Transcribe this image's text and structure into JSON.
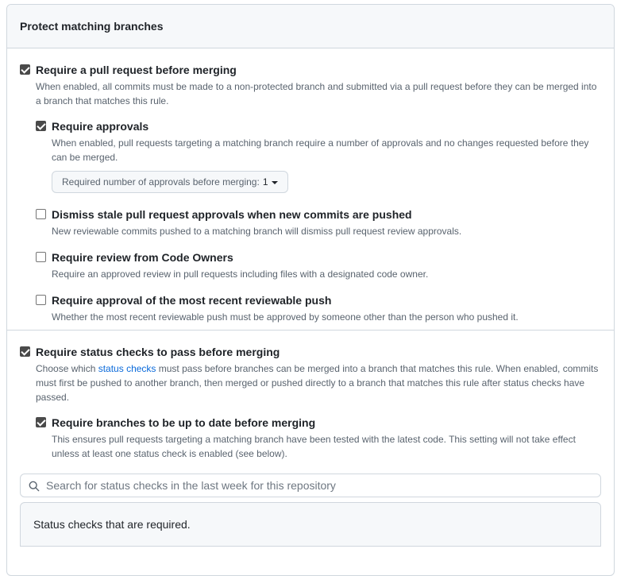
{
  "header": {
    "title": "Protect matching branches"
  },
  "pull_request": {
    "title": "Require a pull request before merging",
    "desc": "When enabled, all commits must be made to a non-protected branch and submitted via a pull request before they can be merged into a branch that matches this rule.",
    "checked": true,
    "options": [
      {
        "title": "Require approvals",
        "desc": "When enabled, pull requests targeting a matching branch require a number of approvals and no changes requested before they can be merged.",
        "checked": true
      },
      {
        "title": "Dismiss stale pull request approvals when new commits are pushed",
        "desc": "New reviewable commits pushed to a matching branch will dismiss pull request review approvals.",
        "checked": false
      },
      {
        "title": "Require review from Code Owners",
        "desc": "Require an approved review in pull requests including files with a designated code owner.",
        "checked": false
      },
      {
        "title": "Require approval of the most recent reviewable push",
        "desc": "Whether the most recent reviewable push must be approved by someone other than the person who pushed it.",
        "checked": false
      }
    ],
    "approvals_dropdown": {
      "label": "Required number of approvals before merging:",
      "value": "1"
    }
  },
  "status_checks": {
    "title": "Require status checks to pass before merging",
    "desc_before": "Choose which ",
    "desc_link": "status checks",
    "desc_after": " must pass before branches can be merged into a branch that matches this rule. When enabled, commits must first be pushed to another branch, then merged or pushed directly to a branch that matches this rule after status checks have passed.",
    "checked": true,
    "up_to_date": {
      "title": "Require branches to be up to date before merging",
      "desc": "This ensures pull requests targeting a matching branch have been tested with the latest code. This setting will not take effect unless at least one status check is enabled (see below).",
      "checked": true
    },
    "search": {
      "placeholder": "Search for status checks in the last week for this repository"
    },
    "required_label": "Status checks that are required."
  }
}
